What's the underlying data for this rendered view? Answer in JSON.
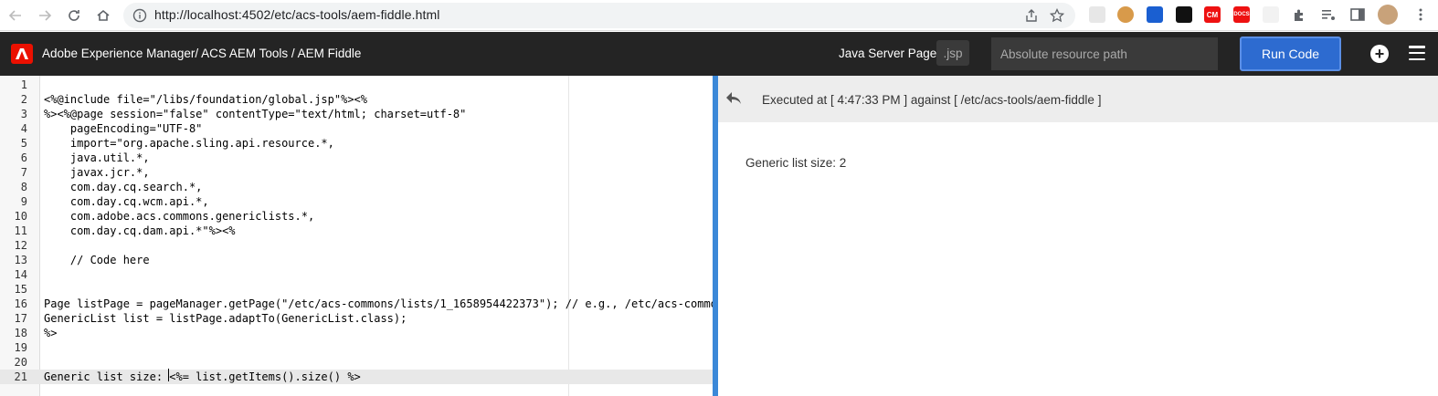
{
  "browser": {
    "url": "http://localhost:4502/etc/acs-tools/aem-fiddle.html"
  },
  "header": {
    "breadcrumb": "Adobe Experience Manager/ ACS AEM Tools / AEM Fiddle",
    "language_label": "Java Server Pages",
    "extension_badge": ".jsp",
    "path_placeholder": "Absolute resource path",
    "run_button_label": "Run Code"
  },
  "editor": {
    "lines": [
      {
        "num": "1",
        "text": ""
      },
      {
        "num": "2",
        "text": "<%@include file=\"/libs/foundation/global.jsp\"%><%"
      },
      {
        "num": "3",
        "text": "%><%@page session=\"false\" contentType=\"text/html; charset=utf-8\""
      },
      {
        "num": "4",
        "text": "    pageEncoding=\"UTF-8\""
      },
      {
        "num": "5",
        "text": "    import=\"org.apache.sling.api.resource.*,"
      },
      {
        "num": "6",
        "text": "    java.util.*,"
      },
      {
        "num": "7",
        "text": "    javax.jcr.*,"
      },
      {
        "num": "8",
        "text": "    com.day.cq.search.*,"
      },
      {
        "num": "9",
        "text": "    com.day.cq.wcm.api.*,"
      },
      {
        "num": "10",
        "text": "    com.adobe.acs.commons.genericlists.*,"
      },
      {
        "num": "11",
        "text": "    com.day.cq.dam.api.*\"%><%"
      },
      {
        "num": "12",
        "text": ""
      },
      {
        "num": "13",
        "text": "    // Code here"
      },
      {
        "num": "14",
        "text": ""
      },
      {
        "num": "15",
        "text": ""
      },
      {
        "num": "16",
        "text": "Page listPage = pageManager.getPage(\"/etc/acs-commons/lists/1_1658954422373\"); // e.g., /etc/acs-commo"
      },
      {
        "num": "17",
        "text": "GenericList list = listPage.adaptTo(GenericList.class);"
      },
      {
        "num": "18",
        "text": "%>"
      },
      {
        "num": "19",
        "text": ""
      },
      {
        "num": "20",
        "text": ""
      },
      {
        "num": "21",
        "text": "Generic list size: <%= list.getItems().size() %>"
      }
    ]
  },
  "output": {
    "executed_text": "Executed at [ 4:47:33 PM ] against [ /etc/acs-tools/aem-fiddle ]",
    "result_text": "Generic list size: 2"
  },
  "extensions": [
    {
      "name": "ext-1",
      "color": "#5f6368"
    },
    {
      "name": "ext-cookie",
      "color": "#c98a3a"
    },
    {
      "name": "ext-blue",
      "color": "#1a5fd1"
    },
    {
      "name": "ext-adobe",
      "color": "#111111"
    },
    {
      "name": "ext-cm",
      "color": "#e11",
      "label": "CM"
    },
    {
      "name": "ext-docs",
      "color": "#e11",
      "label": "DOCS"
    }
  ]
}
